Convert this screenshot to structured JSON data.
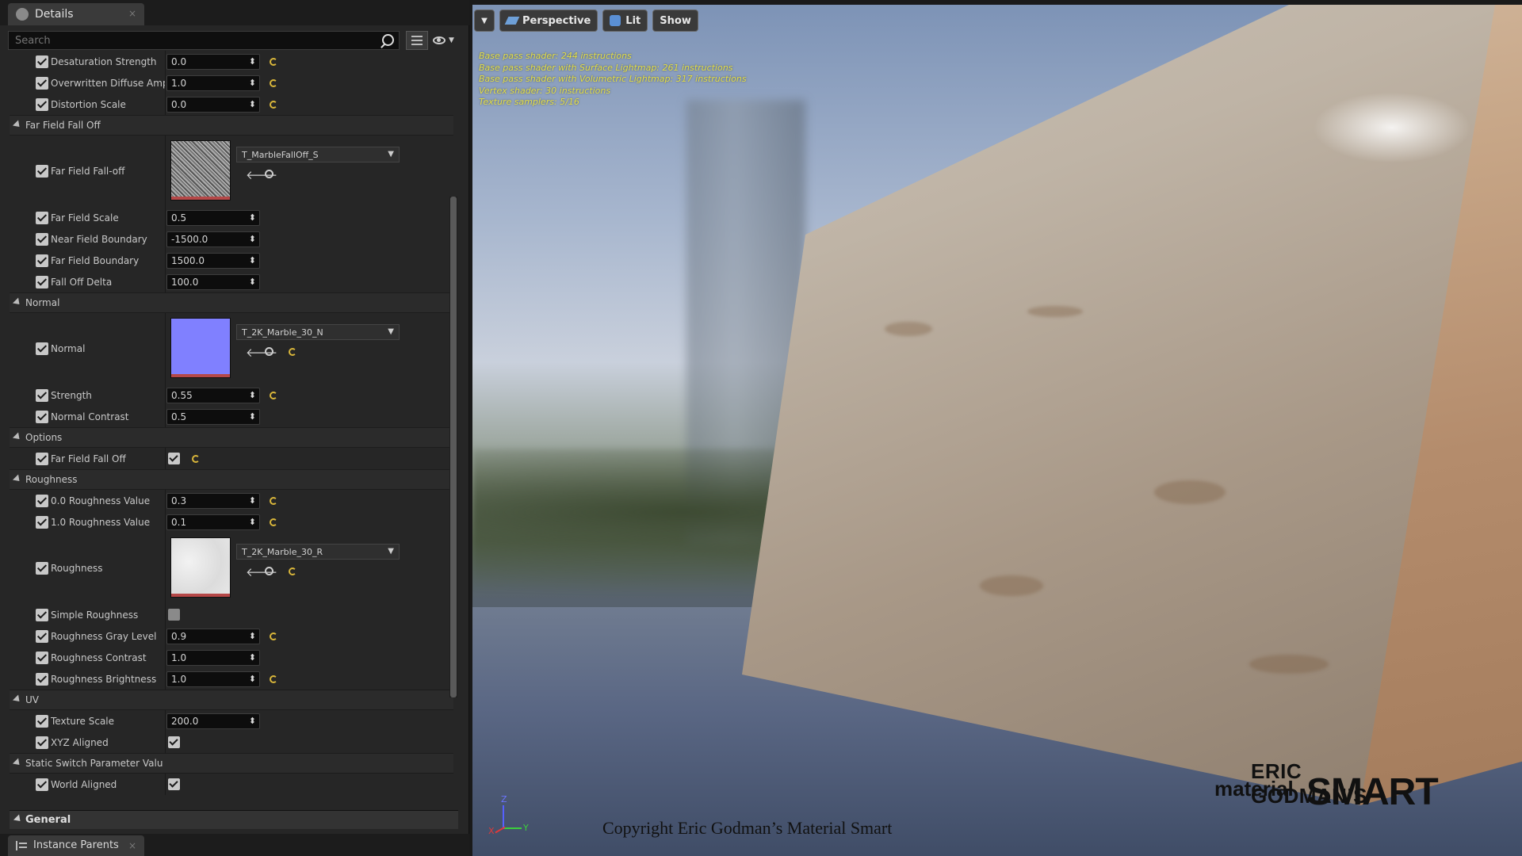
{
  "details": {
    "tab_label": "Details",
    "search_placeholder": "Search"
  },
  "properties": [
    {
      "type": "prop",
      "name": "Desaturation Strength",
      "value": "0.0",
      "reset": true
    },
    {
      "type": "prop",
      "name": "Overwritten Diffuse Ampl",
      "value": "1.0",
      "reset": true
    },
    {
      "type": "prop",
      "name": "Distortion Scale",
      "value": "0.0",
      "reset": true
    },
    {
      "type": "section",
      "label": "Far Field Fall Off"
    },
    {
      "type": "texture",
      "name": "Far Field Fall-off",
      "asset": "T_MarbleFallOff_S",
      "thumb": "noise",
      "reset": false
    },
    {
      "type": "prop",
      "name": "Far Field Scale",
      "value": "0.5",
      "reset": false
    },
    {
      "type": "prop",
      "name": "Near Field Boundary",
      "value": "-1500.0",
      "reset": false
    },
    {
      "type": "prop",
      "name": "Far Field Boundary",
      "value": "1500.0",
      "reset": false
    },
    {
      "type": "prop",
      "name": "Fall Off Delta",
      "value": "100.0",
      "reset": false
    },
    {
      "type": "section",
      "label": "Normal"
    },
    {
      "type": "texture",
      "name": "Normal",
      "asset": "T_2K_Marble_30_N",
      "thumb": "normal",
      "reset": true
    },
    {
      "type": "prop",
      "name": "Strength",
      "value": "0.55",
      "reset": true
    },
    {
      "type": "prop",
      "name": "Normal Contrast",
      "value": "0.5",
      "reset": false
    },
    {
      "type": "section",
      "label": "Options"
    },
    {
      "type": "bool",
      "name": "Far Field Fall Off",
      "checked": true,
      "reset": true
    },
    {
      "type": "section",
      "label": "Roughness"
    },
    {
      "type": "prop",
      "name": "0.0 Roughness Value",
      "value": "0.3",
      "reset": true
    },
    {
      "type": "prop",
      "name": "1.0 Roughness Value",
      "value": "0.1",
      "reset": true
    },
    {
      "type": "texture",
      "name": "Roughness",
      "asset": "T_2K_Marble_30_R",
      "thumb": "rough",
      "reset": true
    },
    {
      "type": "bool",
      "name": "Simple Roughness",
      "checked": false,
      "reset": false
    },
    {
      "type": "prop",
      "name": "Roughness Gray Level",
      "value": "0.9",
      "reset": true
    },
    {
      "type": "prop",
      "name": "Roughness Contrast",
      "value": "1.0",
      "reset": false
    },
    {
      "type": "prop",
      "name": "Roughness Brightness",
      "value": "1.0",
      "reset": true
    },
    {
      "type": "section",
      "label": "UV"
    },
    {
      "type": "prop",
      "name": "Texture Scale",
      "value": "200.0",
      "reset": false
    },
    {
      "type": "bool",
      "name": "XYZ Aligned",
      "checked": true,
      "reset": false
    },
    {
      "type": "section",
      "label": "Static Switch Parameter Valu"
    },
    {
      "type": "bool",
      "name": "World Aligned",
      "checked": true,
      "reset": false
    }
  ],
  "general_label": "General",
  "bottom_tab_label": "Instance Parents",
  "viewport": {
    "perspective_label": "Perspective",
    "lit_label": "Lit",
    "show_label": "Show",
    "stats": [
      "Base pass shader: 244 instructions",
      "Base pass shader with Surface Lightmap: 261 instructions",
      "Base pass shader with Volumetric Lightmap: 317 instructions",
      "Vertex shader: 30 instructions",
      "Texture samplers: 5/16"
    ],
    "axis_labels": {
      "z": "Z",
      "y": "Y",
      "x": "X"
    },
    "copyright": "Copyright Eric Godman’s Material Smart",
    "brand_line1": "ERIC GODMAN’S",
    "brand_line2": "material",
    "brand_line3": "SMART"
  }
}
